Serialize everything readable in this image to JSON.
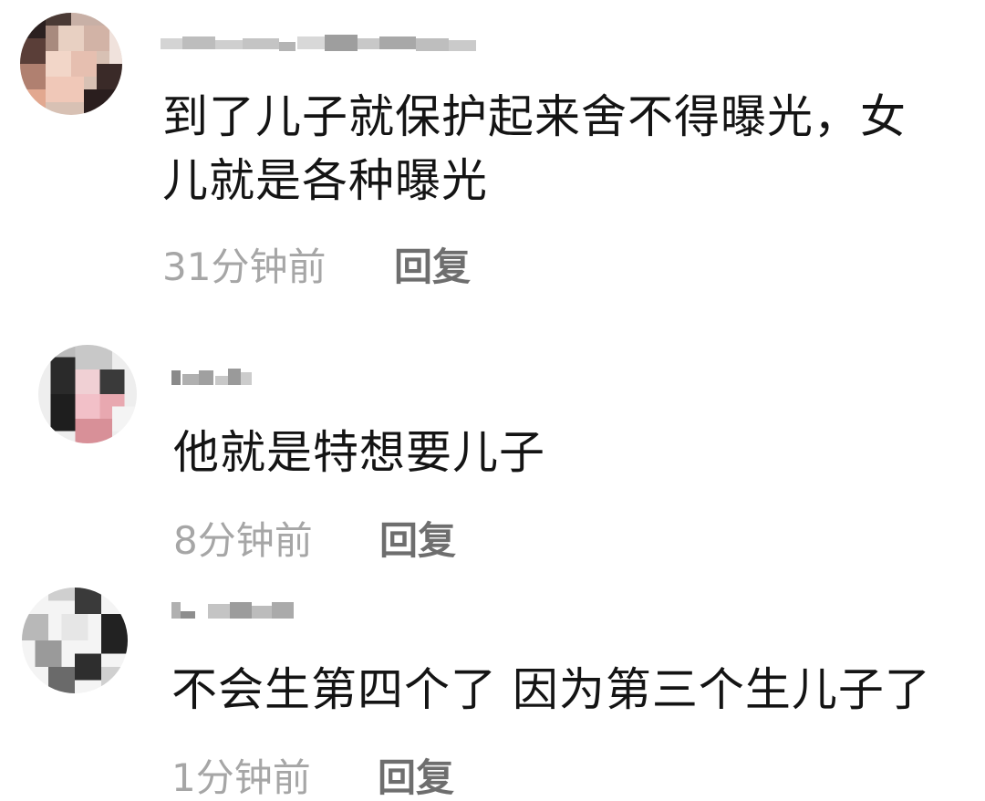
{
  "comments": [
    {
      "text_line1": "到了儿子就保护起来舍不得曝光，女",
      "text_line2": "儿就是各种曝光",
      "time": "31分钟前",
      "reply_label": "回复"
    },
    {
      "text_line1": "他就是特想要儿子",
      "time": "8分钟前",
      "reply_label": "回复"
    },
    {
      "text_line1": "不会生第四个了 因为第三个生儿子了",
      "time": "1分钟前",
      "reply_label": "回复"
    }
  ]
}
